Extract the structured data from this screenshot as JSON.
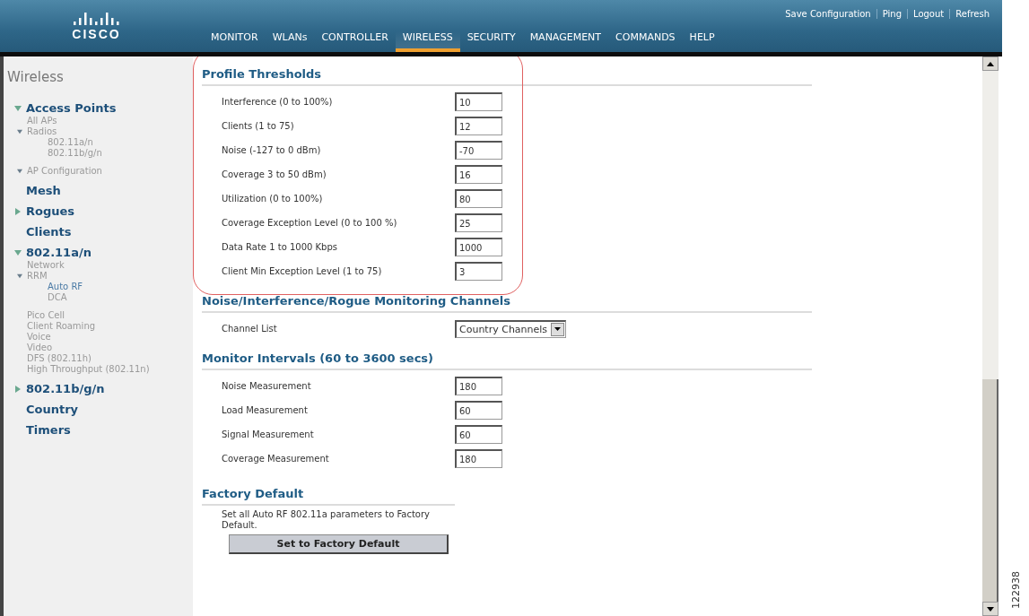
{
  "header": {
    "logo": "CISCO",
    "top_links": [
      "Save Configuration",
      "Ping",
      "Logout",
      "Refresh"
    ],
    "nav": [
      {
        "label": "MONITOR",
        "selected": false
      },
      {
        "label": "WLANs",
        "selected": false
      },
      {
        "label": "CONTROLLER",
        "selected": false
      },
      {
        "label": "WIRELESS",
        "selected": true
      },
      {
        "label": "SECURITY",
        "selected": false
      },
      {
        "label": "MANAGEMENT",
        "selected": false
      },
      {
        "label": "COMMANDS",
        "selected": false
      },
      {
        "label": "HELP",
        "selected": false
      }
    ]
  },
  "sidebar": {
    "title": "Wireless",
    "items": [
      {
        "label": "Access Points",
        "kind": "heading",
        "expanded": true,
        "children": [
          {
            "label": "All APs",
            "kind": "link",
            "selected": false
          },
          {
            "label": "Radios",
            "kind": "link",
            "expanded": true,
            "children": [
              {
                "label": "802.11a/n",
                "kind": "link",
                "selected": false
              },
              {
                "label": "802.11b/g/n",
                "kind": "link",
                "selected": false
              }
            ]
          },
          {
            "label": "AP Configuration",
            "kind": "link",
            "expanded": true
          }
        ]
      },
      {
        "label": "Mesh",
        "kind": "heading"
      },
      {
        "label": "Rogues",
        "kind": "heading",
        "expanded": false
      },
      {
        "label": "Clients",
        "kind": "heading"
      },
      {
        "label": "802.11a/n",
        "kind": "heading",
        "expanded": true,
        "children": [
          {
            "label": "Network",
            "kind": "link",
            "selected": false
          },
          {
            "label": "RRM",
            "kind": "link",
            "expanded": true,
            "children": [
              {
                "label": "Auto RF",
                "kind": "link",
                "selected": true
              },
              {
                "label": "DCA",
                "kind": "link",
                "selected": false
              }
            ]
          },
          {
            "label": "Pico Cell",
            "kind": "link",
            "selected": false
          },
          {
            "label": "Client Roaming",
            "kind": "link",
            "selected": false
          },
          {
            "label": "Voice",
            "kind": "link",
            "selected": false
          },
          {
            "label": "Video",
            "kind": "link",
            "selected": false
          },
          {
            "label": "DFS (802.11h)",
            "kind": "link",
            "selected": false
          },
          {
            "label": "High Throughput (802.11n)",
            "kind": "link",
            "selected": false
          }
        ]
      },
      {
        "label": "802.11b/g/n",
        "kind": "heading",
        "expanded": false
      },
      {
        "label": "Country",
        "kind": "heading"
      },
      {
        "label": "Timers",
        "kind": "heading"
      }
    ]
  },
  "sections": [
    {
      "title": "Profile Thresholds",
      "kind": "form",
      "highlighted": true,
      "rows": [
        {
          "label": "Interference (0 to 100%)",
          "kind": "input",
          "value": "10"
        },
        {
          "label": "Clients (1 to 75)",
          "kind": "input",
          "value": "12"
        },
        {
          "label": "Noise (-127 to 0 dBm)",
          "kind": "input",
          "value": "-70"
        },
        {
          "label": "Coverage 3 to 50 dBm)",
          "kind": "input",
          "value": "16"
        },
        {
          "label": "Utilization (0 to 100%)",
          "kind": "input",
          "value": "80"
        },
        {
          "label": "Coverage Exception Level (0 to 100 %)",
          "kind": "input",
          "value": "25"
        },
        {
          "label": "Data Rate 1 to 1000 Kbps",
          "kind": "input",
          "value": "1000"
        },
        {
          "label": "Client Min Exception Level (1 to 75)",
          "kind": "input",
          "value": "3"
        }
      ]
    },
    {
      "title": "Noise/Interference/Rogue Monitoring Channels",
      "kind": "form",
      "highlighted": false,
      "rows": [
        {
          "label": "Channel List",
          "kind": "select",
          "value": "Country Channels"
        }
      ]
    },
    {
      "title": "Monitor Intervals (60 to 3600 secs)",
      "kind": "form",
      "highlighted": false,
      "rows": [
        {
          "label": "Noise Measurement",
          "kind": "input",
          "value": "180"
        },
        {
          "label": "Load Measurement",
          "kind": "input",
          "value": "60"
        },
        {
          "label": "Signal Measurement",
          "kind": "input",
          "value": "60"
        },
        {
          "label": "Coverage Measurement",
          "kind": "input",
          "value": "180"
        }
      ]
    },
    {
      "title": "Factory Default",
      "kind": "action",
      "highlighted": false,
      "description": "Set all Auto RF 802.11a parameters to Factory Default.",
      "button": "Set to Factory Default"
    }
  ],
  "figure_number": "122938"
}
